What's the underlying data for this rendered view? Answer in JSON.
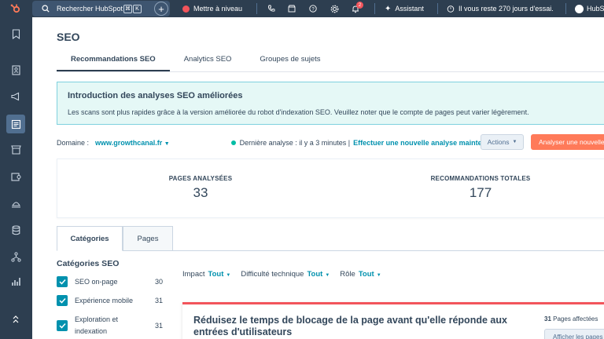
{
  "topbar": {
    "search_placeholder": "Rechercher HubSpot",
    "kbd1": "⌘",
    "kbd2": "K",
    "upgrade": "Mettre à niveau",
    "notif_count": "2",
    "assistant": "Assistant",
    "trial": "Il vous reste 270 jours d'essai.",
    "account": "HubS"
  },
  "page": {
    "title": "SEO",
    "tabs": [
      "Recommandations SEO",
      "Analytics SEO",
      "Groupes de sujets"
    ]
  },
  "banner": {
    "title": "Introduction des analyses SEO améliorées",
    "text": "Les scans sont plus rapides grâce à la version améliorée du robot d'indexation SEO. Veuillez noter que le compte de pages peut varier légèrement."
  },
  "domain": {
    "label": "Domaine :",
    "value": "www.growthcanal.fr",
    "last_scan": "Dernière analyse : il y a 3 minutes |",
    "new_scan_link": "Effectuer une nouvelle analyse maintenant",
    "actions_label": "Actions",
    "analyse_label": "Analyser une nouvelle URL"
  },
  "stats": {
    "pages_label": "PAGES ANALYSÉES",
    "pages_value": "33",
    "reco_label": "RECOMMANDATIONS TOTALES",
    "reco_value": "177"
  },
  "subtabs": [
    "Catégories",
    "Pages"
  ],
  "categories": {
    "title": "Catégories SEO",
    "items": [
      {
        "label": "SEO on-page",
        "count": "30"
      },
      {
        "label": "Expérience mobile",
        "count": "31"
      },
      {
        "label": "Exploration et indexation",
        "count": "31"
      }
    ]
  },
  "filters": {
    "impact_label": "Impact",
    "impact_value": "Tout",
    "difficulty_label": "Difficulté technique",
    "difficulty_value": "Tout",
    "role_label": "Rôle",
    "role_value": "Tout"
  },
  "card": {
    "title": "Réduisez le temps de blocage de la page avant qu'elle réponde aux entrées d'utilisateurs",
    "affected_count": "31",
    "affected_label": "Pages affectées",
    "show_button": "Afficher les pages"
  },
  "colors": {
    "nav_bg": "#2d3e50",
    "accent": "#0091ae",
    "primary_button": "#ff7a59",
    "banner_bg": "#e5f8f6",
    "status_dot": "#00bda5",
    "card_border": "#f2545b"
  }
}
